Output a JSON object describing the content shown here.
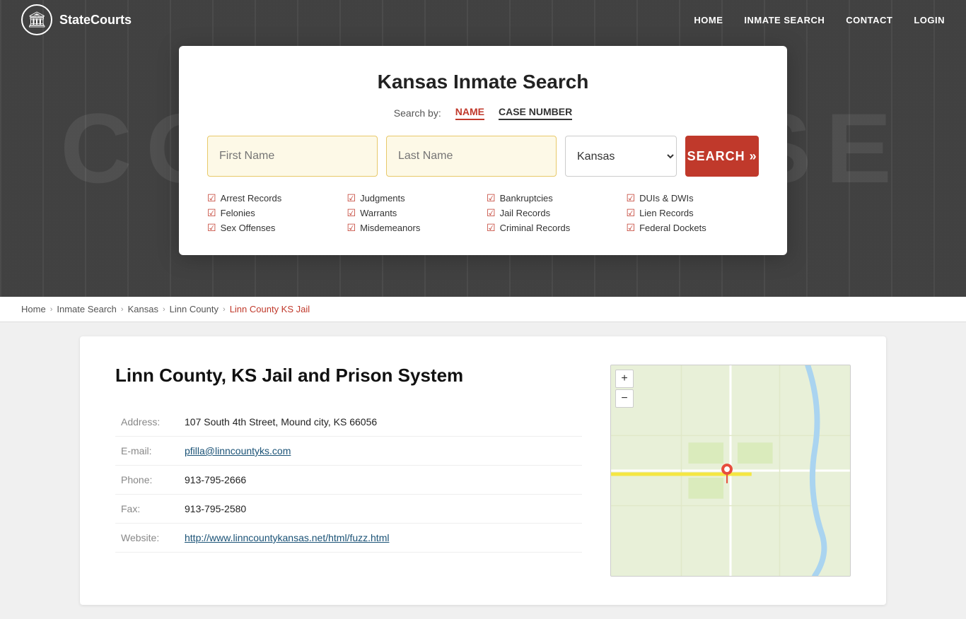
{
  "nav": {
    "logo_text": "StateCourts",
    "logo_icon": "🏛",
    "links": [
      {
        "label": "HOME",
        "href": "#"
      },
      {
        "label": "INMATE SEARCH",
        "href": "#"
      },
      {
        "label": "CONTACT",
        "href": "#"
      },
      {
        "label": "LOGIN",
        "href": "#"
      }
    ]
  },
  "hero": {
    "bg_text": "COURTHOUSE"
  },
  "search_card": {
    "title": "Kansas Inmate Search",
    "search_by_label": "Search by:",
    "tab_name": "NAME",
    "tab_case": "CASE NUMBER",
    "first_name_placeholder": "First Name",
    "last_name_placeholder": "Last Name",
    "state_value": "Kansas",
    "search_button_label": "SEARCH »",
    "checklist": [
      "Arrest Records",
      "Judgments",
      "Bankruptcies",
      "DUIs & DWIs",
      "Felonies",
      "Warrants",
      "Jail Records",
      "Lien Records",
      "Sex Offenses",
      "Misdemeanors",
      "Criminal Records",
      "Federal Dockets"
    ]
  },
  "breadcrumb": {
    "items": [
      "Home",
      "Inmate Search",
      "Kansas",
      "Linn County",
      "Linn County KS Jail"
    ]
  },
  "content": {
    "title": "Linn County, KS Jail and Prison System",
    "fields": [
      {
        "label": "Address:",
        "value": "107 South 4th Street, Mound city, KS 66056",
        "link": false
      },
      {
        "label": "E-mail:",
        "value": "pfilla@linncountyks.com",
        "link": true
      },
      {
        "label": "Phone:",
        "value": "913-795-2666",
        "link": false
      },
      {
        "label": "Fax:",
        "value": "913-795-2580",
        "link": false
      },
      {
        "label": "Website:",
        "value": "http://www.linncountykansas.net/html/fuzz.html",
        "link": true
      }
    ]
  },
  "map": {
    "plus_label": "+",
    "minus_label": "−"
  }
}
